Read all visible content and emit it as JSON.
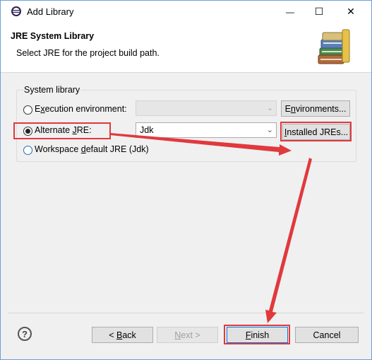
{
  "window": {
    "title": "Add Library",
    "minimize_glyph": "—",
    "maximize_glyph": "☐",
    "close_glyph": "✕"
  },
  "header": {
    "title": "JRE System Library",
    "description": "Select JRE for the project build path."
  },
  "group": {
    "label": "System library",
    "options": [
      {
        "label": "Execution environment:",
        "mnemonic_index": 1,
        "selected": false
      },
      {
        "label": "Alternate JRE:",
        "mnemonic_index": 10,
        "selected": true
      },
      {
        "label": "Workspace default JRE (Jdk)",
        "mnemonic_index": 10,
        "selected": false
      }
    ],
    "execution_env_value": "",
    "alternate_jre_value": "Jdk",
    "environments_button": "Environments...",
    "installed_jres_button": "Installed JREs..."
  },
  "footer": {
    "help": "?",
    "back": "< Back",
    "next": "Next >",
    "finish": "Finish",
    "cancel": "Cancel"
  },
  "colors": {
    "annotation_red": "#e0393e",
    "title_border": "#6d9fd8",
    "focus_blue": "#0078d7"
  }
}
